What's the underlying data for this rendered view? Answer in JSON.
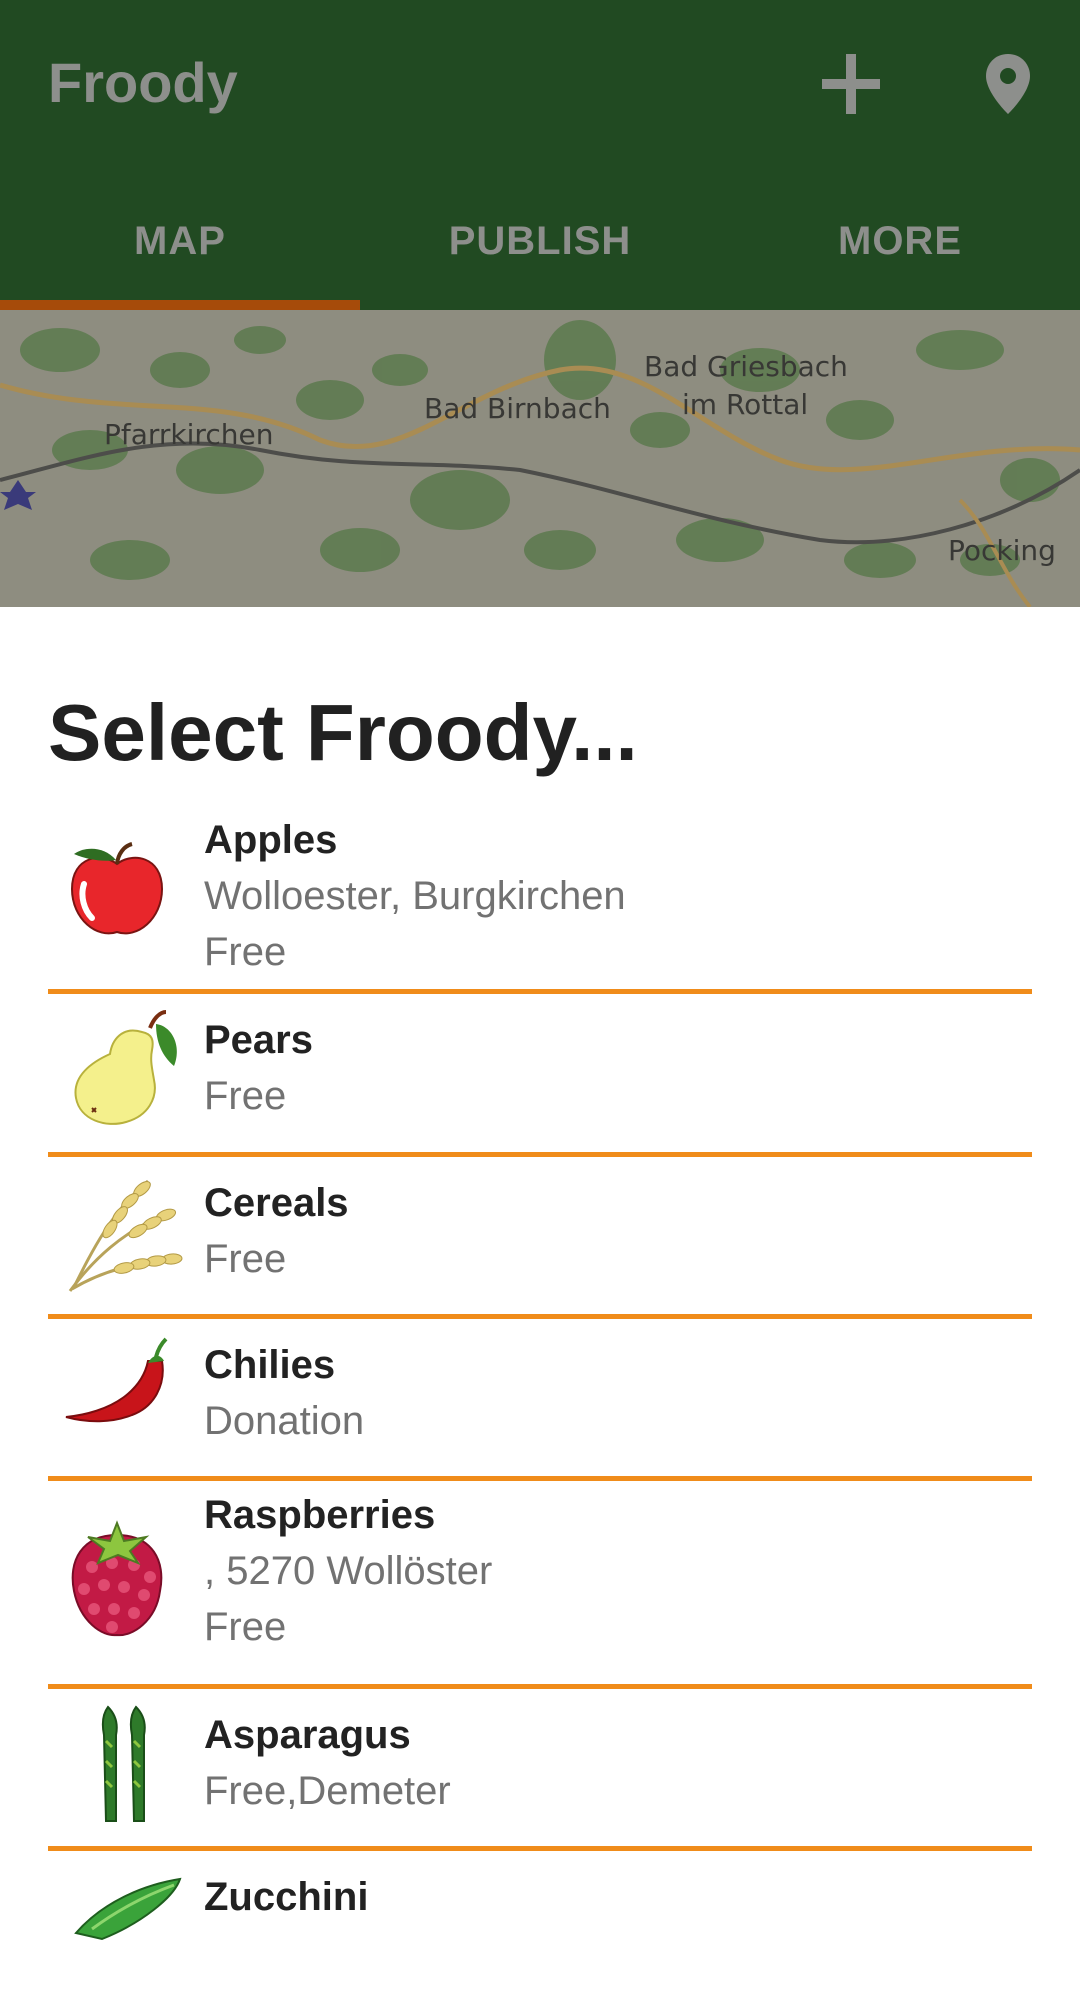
{
  "app": {
    "title": "Froody"
  },
  "toolbar": {
    "add_icon": "plus-icon",
    "location_icon": "location-pin-icon"
  },
  "tabs": [
    {
      "label": "MAP",
      "selected": true
    },
    {
      "label": "PUBLISH",
      "selected": false
    },
    {
      "label": "MORE",
      "selected": false
    }
  ],
  "map": {
    "labels": [
      "Bad Griesbach",
      "im Rottal",
      "Bad Birnbach",
      "Pfarrkirchen",
      "Pocking"
    ]
  },
  "sheet": {
    "title": "Select Froody..."
  },
  "items": [
    {
      "name": "Apples",
      "lines": [
        "Wolloester, Burgkirchen",
        "Free"
      ],
      "icon": "apple-icon"
    },
    {
      "name": "Pears",
      "lines": [
        "Free"
      ],
      "icon": "pear-icon"
    },
    {
      "name": "Cereals",
      "lines": [
        "Free"
      ],
      "icon": "wheat-icon"
    },
    {
      "name": "Chilies",
      "lines": [
        "Donation"
      ],
      "icon": "chili-icon"
    },
    {
      "name": "Raspberries",
      "lines": [
        ", 5270 Wollöster",
        "Free"
      ],
      "icon": "raspberry-icon"
    },
    {
      "name": "Asparagus",
      "lines": [
        "Free,Demeter"
      ],
      "icon": "asparagus-icon"
    },
    {
      "name": "Zucchini",
      "lines": [],
      "icon": "zucchini-icon"
    }
  ],
  "colors": {
    "toolbar": "#214a22",
    "tab_indicator": "#a64b0a",
    "divider": "#f08c1a"
  }
}
